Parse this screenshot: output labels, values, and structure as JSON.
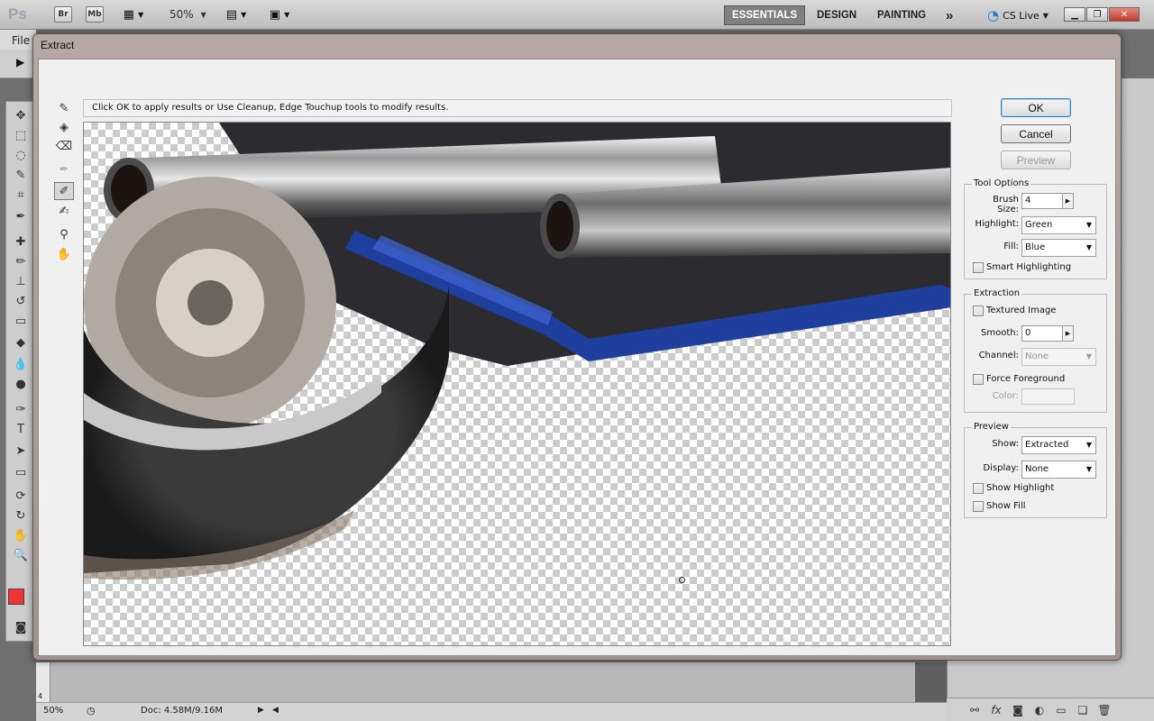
{
  "appbar": {
    "logo": "Ps",
    "bridge": "Br",
    "minibridge": "Mb",
    "zoom": "50%",
    "workspaces": [
      "ESSENTIALS",
      "DESIGN",
      "PAINTING"
    ],
    "more": "»",
    "cs_live": "CS Live"
  },
  "menu": {
    "file": "File"
  },
  "dialog": {
    "title": "Extract",
    "instruction": "Click OK to apply results or Use Cleanup, Edge Touchup tools to modify results.",
    "buttons": {
      "ok": "OK",
      "cancel": "Cancel",
      "preview": "Preview"
    },
    "tool_options": {
      "title": "Tool Options",
      "brush_size_label": "Brush Size:",
      "brush_size": "4",
      "highlight_label": "Highlight:",
      "highlight": "Green",
      "fill_label": "Fill:",
      "fill": "Blue",
      "smart_highlighting": "Smart Highlighting"
    },
    "extraction": {
      "title": "Extraction",
      "textured_image": "Textured Image",
      "smooth_label": "Smooth:",
      "smooth": "0",
      "channel_label": "Channel:",
      "channel": "None",
      "force_foreground": "Force Foreground",
      "color_label": "Color:"
    },
    "preview": {
      "title": "Preview",
      "show_label": "Show:",
      "show": "Extracted",
      "display_label": "Display:",
      "display": "None",
      "show_highlight": "Show Highlight",
      "show_fill": "Show Fill"
    }
  },
  "status": {
    "zoom": "50%",
    "doc": "Doc: 4.58M/9.16M"
  },
  "ruler": {
    "mark": "4"
  },
  "colors": {
    "foreground": "#ee3434",
    "ok_border": "#3c7fb1",
    "bike_blue": "#1f3f9e"
  }
}
